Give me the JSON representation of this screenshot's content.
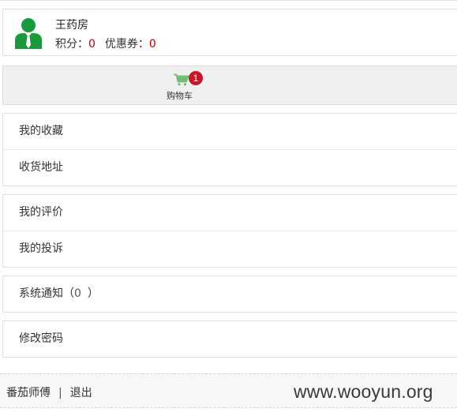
{
  "profile": {
    "name": "王药房",
    "points_label": "积分：",
    "points_value": "0",
    "coupons_label": "优惠券：",
    "coupons_value": "0"
  },
  "cart": {
    "label": "购物车",
    "badge_count": "1",
    "icon": "shopping-cart-icon",
    "icon_color": "#6cbf6c"
  },
  "menu_groups": [
    [
      {
        "label": "我的收藏"
      },
      {
        "label": "收货地址"
      }
    ],
    [
      {
        "label": "我的评价"
      },
      {
        "label": "我的投诉"
      }
    ],
    [
      {
        "label": "系统通知（",
        "count": "0",
        "suffix": "）"
      }
    ],
    [
      {
        "label": "修改密码"
      }
    ]
  ],
  "footer": {
    "username": "番茄师傅",
    "separator": "|",
    "logout": "退出"
  },
  "watermark": "www.wooyun.org",
  "colors": {
    "accent_red": "#c40000",
    "avatar_green": "#1a9a3c",
    "badge_red": "#c81623"
  }
}
